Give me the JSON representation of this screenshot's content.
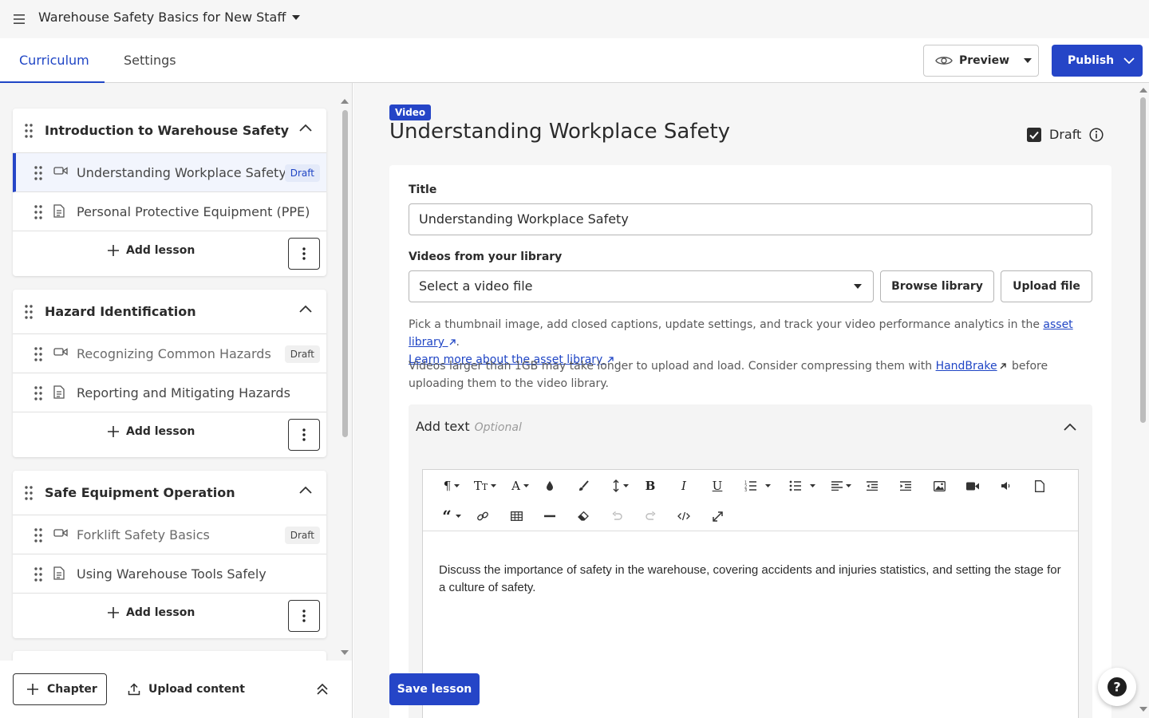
{
  "header": {
    "course_title": "Warehouse Safety Basics for New Staff",
    "tabs": [
      {
        "label": "Curriculum"
      },
      {
        "label": "Settings"
      }
    ],
    "preview_label": "Preview",
    "publish_label": "Publish"
  },
  "sidebar": {
    "chapters": [
      {
        "title": "Introduction to Warehouse Safety",
        "lessons": [
          {
            "title": "Understanding Workplace Safety",
            "type": "video",
            "badge": "Draft"
          },
          {
            "title": "Personal Protective Equipment (PPE)",
            "type": "text",
            "badge": ""
          }
        ],
        "add_lesson_label": "Add lesson"
      },
      {
        "title": "Hazard Identification",
        "lessons": [
          {
            "title": "Recognizing Common Hazards",
            "type": "video",
            "badge": "Draft"
          },
          {
            "title": "Reporting and Mitigating Hazards",
            "type": "text",
            "badge": ""
          }
        ],
        "add_lesson_label": "Add lesson"
      },
      {
        "title": "Safe Equipment Operation",
        "lessons": [
          {
            "title": "Forklift Safety Basics",
            "type": "video",
            "badge": "Draft"
          },
          {
            "title": "Using Warehouse Tools Safely",
            "type": "text",
            "badge": ""
          }
        ],
        "add_lesson_label": "Add lesson"
      }
    ],
    "footer": {
      "chapter_label": "Chapter",
      "upload_label": "Upload content"
    }
  },
  "main": {
    "type_badge": "Video",
    "lesson_heading": "Understanding Workplace Safety",
    "draft_label": "Draft",
    "draft_checked": true,
    "title_label": "Title",
    "title_value": "Understanding Workplace Safety",
    "videos_label": "Videos from your library",
    "video_select_value": "Select a video file",
    "browse_label": "Browse library",
    "upload_file_label": "Upload file",
    "help1_text": "Pick a thumbnail image, add closed captions, update settings, and track your video performance analytics in the",
    "help1_link": "asset library",
    "help1_link2": "Learn more about the asset library",
    "help2_text": "Videos larger than 1GB may take longer to upload and load. Consider compressing them with",
    "help2_link": "HandBrake",
    "help2_after": "before uploading them to the video library.",
    "add_text_label": "Add text",
    "optional_label": "Optional",
    "editor_text": "Discuss the importance of safety in the warehouse, covering accidents and injuries statistics, and setting the stage for a culture of safety.",
    "save_label": "Save lesson"
  },
  "colors": {
    "accent": "#2545c7",
    "selected_bg": "#f2f5fd"
  }
}
